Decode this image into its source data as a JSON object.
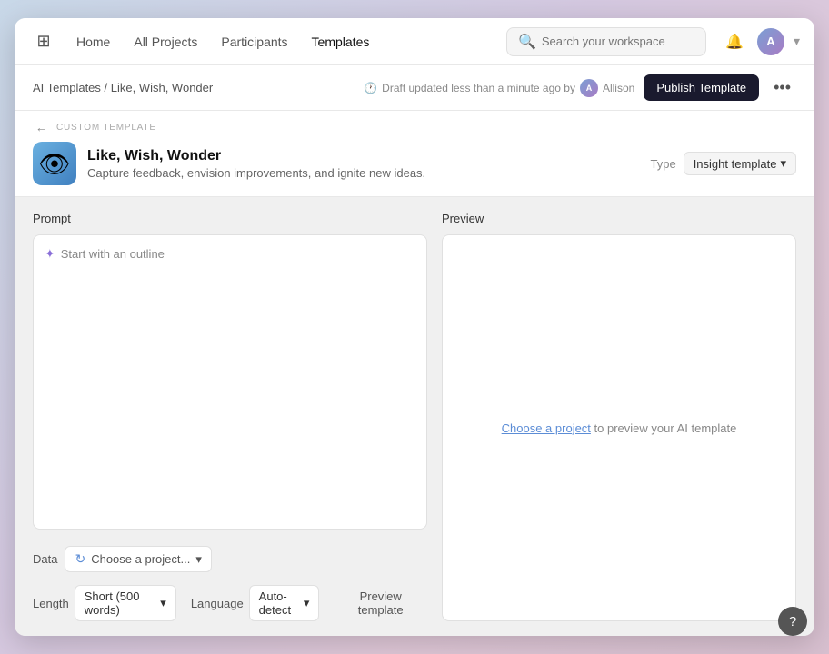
{
  "nav": {
    "grid_icon": "⊞",
    "links": [
      {
        "label": "Home",
        "active": false
      },
      {
        "label": "All Projects",
        "active": false
      },
      {
        "label": "Participants",
        "active": false
      },
      {
        "label": "Templates",
        "active": true
      }
    ],
    "search_placeholder": "Search your workspace",
    "bell_icon": "🔔",
    "avatar_initials": "A"
  },
  "breadcrumb": {
    "path": "AI Templates / Like, Wish, Wonder",
    "draft_status": "Draft updated less than a minute ago by",
    "author": "Allison",
    "publish_label": "Publish Template",
    "more_icon": "•••"
  },
  "template": {
    "custom_label": "CUSTOM TEMPLATE",
    "back_icon": "←",
    "icon_emoji": "👁",
    "name": "Like, Wish, Wonder",
    "description": "Capture feedback, envision improvements, and ignite new ideas.",
    "type_label": "Type",
    "type_value": "Insight template",
    "chevron": "▾"
  },
  "prompt": {
    "label": "Prompt",
    "outline_icon": "✦",
    "outline_label": "Start with an outline",
    "placeholder": ""
  },
  "controls": {
    "data_label": "Data",
    "sync_icon": "↻",
    "choose_project_label": "Choose a project...",
    "chevron": "▾",
    "length_label": "Length",
    "length_value": "Short (500 words)",
    "length_chevron": "▾",
    "language_label": "Language",
    "language_value": "Auto-detect",
    "language_chevron": "▾",
    "preview_label": "Preview template"
  },
  "preview": {
    "label": "Preview",
    "choose_link": "Choose a project",
    "suffix": "to preview your AI template"
  },
  "help": {
    "icon": "?"
  }
}
